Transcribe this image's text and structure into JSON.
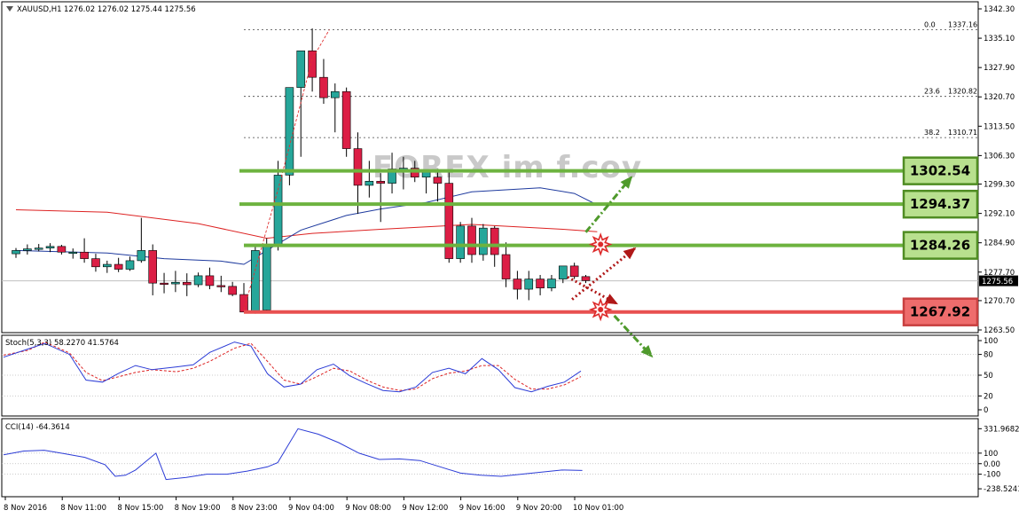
{
  "header": {
    "symbol": "XAUUSD,H1",
    "ohlc": "1276.02 1276.02 1275.44 1275.56",
    "arrow_icon": "triangle-down-icon"
  },
  "watermark": "FOREX im f.cov",
  "colors": {
    "bull": "#26a69a",
    "bear": "#dc1e45",
    "support": "#e85050",
    "resistance": "#6db33f",
    "ma_slow": "#dd2222",
    "ma_fast": "#1e3a9e",
    "stoch_main": "#2c3cd6",
    "stoch_signal": "#dd2222",
    "cci": "#2c3cd6"
  },
  "chart_data": [
    {
      "type": "candlestick",
      "title": "XAUUSD,H1",
      "ylim": [
        1263.5,
        1342.3
      ],
      "y_ticks": [
        "1342.30",
        "1335.10",
        "1327.90",
        "1320.70",
        "1313.50",
        "1306.30",
        "1299.30",
        "1292.10",
        "1284.90",
        "1277.70",
        "1270.70",
        "1263.50"
      ],
      "current_price": "1275.56",
      "x_labels": [
        "8 Nov 2016",
        "8 Nov 11:00",
        "8 Nov 15:00",
        "8 Nov 19:00",
        "8 Nov 23:00",
        "9 Nov 04:00",
        "9 Nov 08:00",
        "9 Nov 12:00",
        "9 Nov 16:00",
        "9 Nov 20:00",
        "10 Nov 01:00"
      ],
      "candles": [
        [
          1282.2,
          1283.6,
          1281.2,
          1283.0
        ],
        [
          1283.0,
          1284.5,
          1282.0,
          1283.4
        ],
        [
          1283.4,
          1284.6,
          1282.8,
          1283.6
        ],
        [
          1283.6,
          1284.8,
          1282.6,
          1284.0
        ],
        [
          1284.0,
          1284.4,
          1282.0,
          1282.6
        ],
        [
          1282.6,
          1283.5,
          1281.0,
          1282.6
        ],
        [
          1282.6,
          1286.0,
          1280.0,
          1281.0
        ],
        [
          1281.0,
          1282.2,
          1277.8,
          1279.0
        ],
        [
          1279.0,
          1280.5,
          1277.5,
          1279.6
        ],
        [
          1279.6,
          1281.2,
          1277.7,
          1278.4
        ],
        [
          1278.4,
          1281.5,
          1278.0,
          1280.5
        ],
        [
          1280.5,
          1291.0,
          1280.0,
          1283.0
        ],
        [
          1283.0,
          1284.5,
          1272.0,
          1275.0
        ],
        [
          1275.0,
          1277.5,
          1272.5,
          1274.8
        ],
        [
          1274.8,
          1278.0,
          1272.8,
          1275.2
        ],
        [
          1275.2,
          1277.4,
          1271.8,
          1274.6
        ],
        [
          1274.6,
          1277.6,
          1274.0,
          1276.8
        ],
        [
          1276.8,
          1278.8,
          1273.5,
          1274.4
        ],
        [
          1274.4,
          1276.8,
          1272.8,
          1274.2
        ],
        [
          1274.2,
          1275.3,
          1271.8,
          1272.2
        ],
        [
          1272.2,
          1275.0,
          1270.5,
          1267.9
        ],
        [
          1267.9,
          1284.0,
          1267.5,
          1283.0
        ],
        [
          1268.4,
          1286.0,
          1268.0,
          1284.0
        ],
        [
          1284.5,
          1305.0,
          1283.0,
          1301.5
        ],
        [
          1301.5,
          1311.0,
          1299.0,
          1323.0
        ],
        [
          1323.0,
          1330.5,
          1306.0,
          1332.0
        ],
        [
          1332.0,
          1337.5,
          1322.0,
          1325.5
        ],
        [
          1325.5,
          1330.0,
          1319.0,
          1320.5
        ],
        [
          1320.5,
          1324.0,
          1312.0,
          1322.0
        ],
        [
          1322.0,
          1323.0,
          1306.0,
          1308.0
        ],
        [
          1308.0,
          1312.0,
          1292.0,
          1299.0
        ],
        [
          1299.0,
          1305.0,
          1296.0,
          1300.0
        ],
        [
          1300.0,
          1302.0,
          1290.0,
          1299.5
        ],
        [
          1299.5,
          1307.0,
          1297.0,
          1303.0
        ],
        [
          1303.0,
          1306.0,
          1298.0,
          1303.2
        ],
        [
          1303.2,
          1305.0,
          1299.8,
          1301.0
        ],
        [
          1301.0,
          1302.0,
          1297.0,
          1302.5
        ],
        [
          1301.0,
          1303.0,
          1295.0,
          1299.5
        ],
        [
          1299.5,
          1302.5,
          1280.0,
          1281.0
        ],
        [
          1281.0,
          1290.0,
          1280.0,
          1289.0
        ],
        [
          1289.0,
          1291.0,
          1280.0,
          1282.0
        ],
        [
          1282.0,
          1289.5,
          1280.5,
          1288.5
        ],
        [
          1288.5,
          1289.0,
          1279.0,
          1282.0
        ],
        [
          1282.0,
          1285.0,
          1274.0,
          1276.0
        ],
        [
          1276.0,
          1278.0,
          1271.0,
          1273.5
        ],
        [
          1273.5,
          1278.0,
          1270.8,
          1276.0
        ],
        [
          1276.0,
          1277.0,
          1272.0,
          1273.8
        ],
        [
          1273.8,
          1277.0,
          1273.0,
          1276.0
        ],
        [
          1276.0,
          1279.0,
          1275.0,
          1279.2
        ],
        [
          1279.2,
          1280.0,
          1276.0,
          1276.6
        ],
        [
          1276.6,
          1277.0,
          1275.0,
          1275.6
        ]
      ],
      "levels": [
        {
          "label": "1302.54",
          "value": 1302.54,
          "kind": "resistance"
        },
        {
          "label": "1294.37",
          "value": 1294.37,
          "kind": "resistance"
        },
        {
          "label": "1284.26",
          "value": 1284.26,
          "kind": "resistance"
        },
        {
          "label": "1267.92",
          "value": 1267.92,
          "kind": "support"
        }
      ],
      "fibonacci": [
        {
          "ratio": "0.0",
          "price": "1337.16",
          "value": 1337.16
        },
        {
          "ratio": "23.6",
          "price": "1320.82",
          "value": 1320.82
        },
        {
          "ratio": "38.2",
          "price": "1310.71",
          "value": 1310.71
        }
      ],
      "ma_slow": [
        [
          0,
          1293.0
        ],
        [
          8,
          1292.4
        ],
        [
          16,
          1289.6
        ],
        [
          22,
          1286.0
        ],
        [
          26,
          1287.2
        ],
        [
          32,
          1288.2
        ],
        [
          40,
          1289.4
        ],
        [
          48,
          1288.2
        ],
        [
          51,
          1287.6
        ]
      ],
      "ma_fast": [
        [
          0,
          1283.0
        ],
        [
          8,
          1282.4
        ],
        [
          13,
          1281.0
        ],
        [
          18,
          1280.4
        ],
        [
          20,
          1279.6
        ],
        [
          22,
          1283.0
        ],
        [
          25,
          1288.0
        ],
        [
          29,
          1291.6
        ],
        [
          32,
          1293.2
        ],
        [
          36,
          1294.8
        ],
        [
          40,
          1297.4
        ],
        [
          46,
          1298.4
        ],
        [
          49,
          1297.0
        ],
        [
          51,
          1294.2
        ]
      ],
      "arrows": [
        {
          "name": "break-up-arrow",
          "style": "dash-dot",
          "direction": "up",
          "from_bar": 50,
          "to_bar": 54,
          "from": 1287.5,
          "to": 1301.0,
          "color": "#4f9a2c"
        },
        {
          "name": "bounce-up-arrow",
          "style": "dotted",
          "direction": "up",
          "from_bar": 48.8,
          "to_bar": 54.3,
          "from": 1271.0,
          "to": 1283.5,
          "color": "#b01818"
        },
        {
          "name": "pullback-down-arrow",
          "style": "dotted",
          "direction": "down",
          "from_bar": 48.4,
          "to_bar": 52.7,
          "from": 1276.5,
          "to": 1270.0,
          "color": "#b01818"
        },
        {
          "name": "break-down-arrow",
          "style": "dash-dot",
          "direction": "down",
          "from_bar": 52.5,
          "to_bar": 55.8,
          "from": 1267.0,
          "to": 1257.0,
          "color": "#4f9a2c"
        }
      ],
      "stars": [
        {
          "name": "resistance-hit-star-icon",
          "bar": 51.3,
          "price": 1284.5
        },
        {
          "name": "support-hit-star-icon",
          "bar": 51.3,
          "price": 1268.5
        }
      ]
    },
    {
      "type": "line",
      "title": "Stoch(5,3,3) 58.2270 41.5764",
      "ylim": [
        0,
        100
      ],
      "y_ticks": [
        "100",
        "80",
        "50",
        "20",
        "0"
      ],
      "series": [
        {
          "values": [
            [
              0,
              76
            ],
            [
              3,
              88
            ],
            [
              5,
              96
            ],
            [
              8,
              80
            ],
            [
              10,
              43
            ],
            [
              12,
              40
            ],
            [
              14,
              53
            ],
            [
              16,
              64
            ],
            [
              18,
              58
            ],
            [
              21,
              62
            ],
            [
              23,
              65
            ],
            [
              25,
              83
            ],
            [
              28,
              98
            ],
            [
              30,
              92
            ],
            [
              32,
              52
            ],
            [
              34,
              33
            ],
            [
              36,
              37
            ],
            [
              38,
              58
            ],
            [
              40,
              66
            ],
            [
              42,
              49
            ],
            [
              44,
              38
            ],
            [
              46,
              28
            ],
            [
              48,
              26
            ],
            [
              50,
              33
            ],
            [
              52,
              54
            ],
            [
              54,
              60
            ],
            [
              56,
              52
            ],
            [
              58,
              74
            ],
            [
              60,
              58
            ],
            [
              62,
              32
            ],
            [
              64,
              26
            ],
            [
              66,
              34
            ],
            [
              68,
              40
            ],
            [
              70,
              56
            ]
          ]
        },
        {
          "values": [
            [
              0,
              79
            ],
            [
              3,
              86
            ],
            [
              5,
              98
            ],
            [
              8,
              82
            ],
            [
              10,
              54
            ],
            [
              12,
              42
            ],
            [
              14,
              48
            ],
            [
              16,
              54
            ],
            [
              18,
              58
            ],
            [
              21,
              55
            ],
            [
              23,
              60
            ],
            [
              25,
              70
            ],
            [
              28,
              89
            ],
            [
              30,
              96
            ],
            [
              32,
              70
            ],
            [
              34,
              43
            ],
            [
              36,
              37
            ],
            [
              38,
              48
            ],
            [
              40,
              60
            ],
            [
              42,
              56
            ],
            [
              44,
              43
            ],
            [
              46,
              33
            ],
            [
              48,
              28
            ],
            [
              50,
              30
            ],
            [
              52,
              45
            ],
            [
              54,
              53
            ],
            [
              56,
              56
            ],
            [
              58,
              64
            ],
            [
              60,
              64
            ],
            [
              62,
              44
            ],
            [
              64,
              30
            ],
            [
              66,
              30
            ],
            [
              68,
              36
            ],
            [
              70,
              48
            ]
          ]
        }
      ]
    },
    {
      "type": "line",
      "title": "CCI(14) -64.3614",
      "ylim": [
        -280,
        360
      ],
      "y_ticks": [
        "331.9682",
        "100",
        "0.00",
        "-100",
        "-238.5241"
      ],
      "series": [
        {
          "values": [
            [
              0,
              85
            ],
            [
              2,
              120
            ],
            [
              4,
              128
            ],
            [
              6,
              95
            ],
            [
              8,
              60
            ],
            [
              10,
              -10
            ],
            [
              11,
              -120
            ],
            [
              12,
              -110
            ],
            [
              13,
              -60
            ],
            [
              15,
              100
            ],
            [
              16,
              -150
            ],
            [
              18,
              -130
            ],
            [
              20,
              -100
            ],
            [
              22,
              -100
            ],
            [
              24,
              -70
            ],
            [
              26,
              -30
            ],
            [
              27,
              10
            ],
            [
              29,
              331
            ],
            [
              31,
              280
            ],
            [
              33,
              200
            ],
            [
              35,
              100
            ],
            [
              37,
              40
            ],
            [
              39,
              45
            ],
            [
              41,
              30
            ],
            [
              43,
              -30
            ],
            [
              45,
              -90
            ],
            [
              47,
              -110
            ],
            [
              49,
              -120
            ],
            [
              51,
              -100
            ],
            [
              53,
              -80
            ],
            [
              55,
              -60
            ],
            [
              57,
              -64
            ]
          ]
        }
      ]
    }
  ]
}
